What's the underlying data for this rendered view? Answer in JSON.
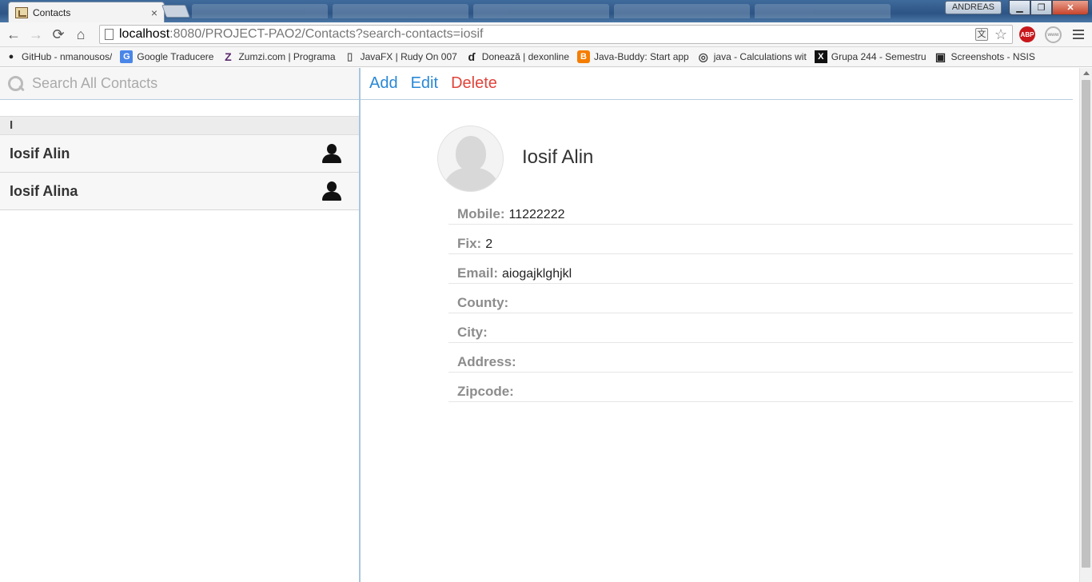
{
  "browser": {
    "tab": {
      "title": "Contacts",
      "close": "×"
    },
    "window": {
      "user": "ANDREAS",
      "minimize": "▁",
      "maximize": "❐",
      "close": "✕"
    },
    "url": {
      "host": "localhost",
      "rest": ":8080/PROJECT-PAO2/Contacts?search-contacts=iosif"
    },
    "nav": {
      "back": "←",
      "forward": "→",
      "reload": "⟳",
      "home": "⌂"
    },
    "translate": "文",
    "star": "☆",
    "abp": "ABP",
    "www": "www"
  },
  "bookmarks": [
    {
      "label": "GitHub - nmanousos/",
      "icon": "github-icon",
      "glyph": "●"
    },
    {
      "label": "Google Traducere",
      "icon": "google-translate-icon",
      "glyph": "G"
    },
    {
      "label": "Zumzi.com | Programa",
      "icon": "zumzi-icon",
      "glyph": "Z"
    },
    {
      "label": "JavaFX | Rudy On 007",
      "icon": "page-icon",
      "glyph": "▯"
    },
    {
      "label": "Donează | dexonline",
      "icon": "dexonline-icon",
      "glyph": "ɗ"
    },
    {
      "label": "Java-Buddy: Start app",
      "icon": "blogger-icon",
      "glyph": "B"
    },
    {
      "label": "java - Calculations wit",
      "icon": "globe-icon",
      "glyph": "◎"
    },
    {
      "label": "Grupa 244 - Semestru",
      "icon": "x-icon",
      "glyph": "X"
    },
    {
      "label": "Screenshots - NSIS",
      "icon": "nsis-icon",
      "glyph": "▣"
    }
  ],
  "sidebar": {
    "search_placeholder": "Search All Contacts",
    "group_letter": "I",
    "contacts": [
      {
        "name": "Iosif Alin"
      },
      {
        "name": "Iosif Alina"
      }
    ]
  },
  "actions": {
    "add": "Add",
    "edit": "Edit",
    "delete": "Delete"
  },
  "detail": {
    "name": "Iosif Alin",
    "fields": [
      {
        "label": "Mobile:",
        "value": "11222222"
      },
      {
        "label": "Fix:",
        "value": "2"
      },
      {
        "label": "Email:",
        "value": "aiogajklghjkl"
      },
      {
        "label": "County:",
        "value": ""
      },
      {
        "label": "City:",
        "value": ""
      },
      {
        "label": "Address:",
        "value": ""
      },
      {
        "label": "Zipcode:",
        "value": ""
      }
    ]
  },
  "colors": {
    "action_blue": "#2a88d6",
    "action_red": "#e0443b",
    "divider_blue": "#a9c6dc",
    "label_gray": "#8c8c8c"
  }
}
